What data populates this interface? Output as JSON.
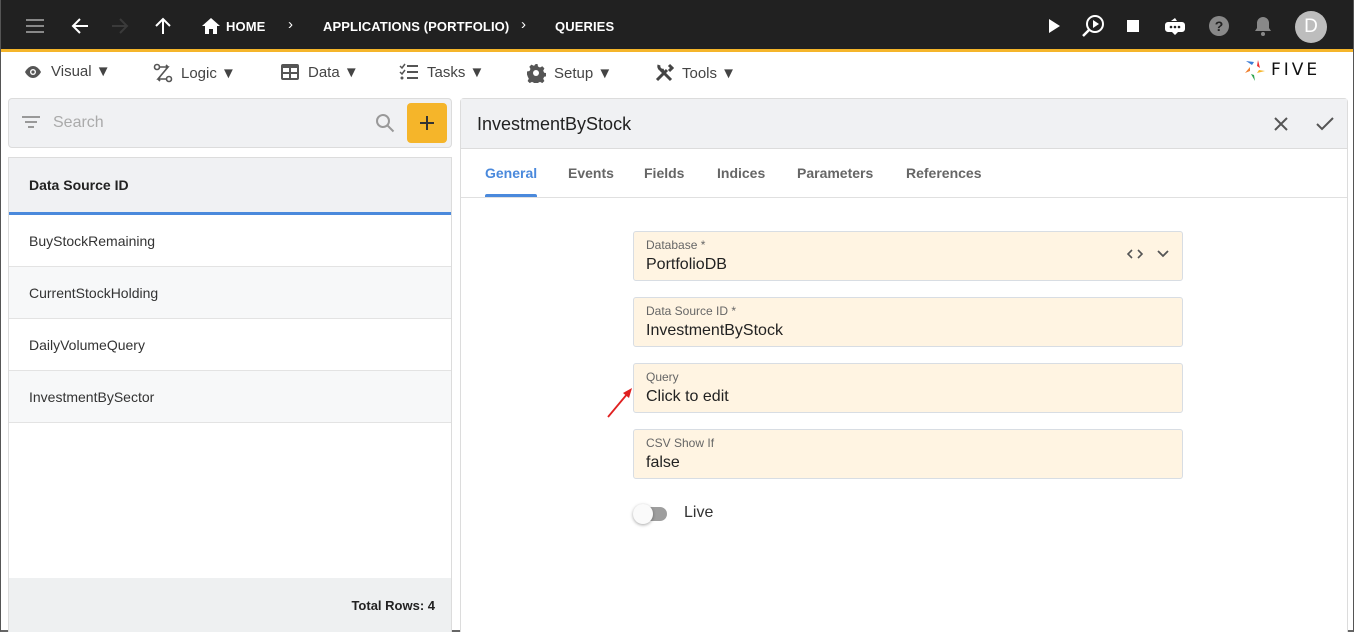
{
  "topbar": {
    "breadcrumbs": [
      {
        "label": "HOME",
        "icon": "home-icon"
      },
      {
        "label": "APPLICATIONS (PORTFOLIO)"
      },
      {
        "label": "QUERIES"
      }
    ],
    "icons": [
      "menu-icon",
      "back-arrow-icon",
      "forward-arrow-icon",
      "up-arrow-icon",
      "play-icon",
      "search-play-icon",
      "stop-icon",
      "chat-bot-icon",
      "help-icon",
      "bell-icon"
    ],
    "avatar_initial": "D",
    "accent_color": "#f5b52a"
  },
  "menubar": {
    "items": [
      {
        "label": "Visual ▼",
        "icon": "eye-icon"
      },
      {
        "label": "Logic ▼",
        "icon": "logic-icon"
      },
      {
        "label": "Data ▼",
        "icon": "table-icon"
      },
      {
        "label": "Tasks ▼",
        "icon": "tasks-icon"
      },
      {
        "label": "Setup ▼",
        "icon": "gear-icon"
      },
      {
        "label": "Tools ▼",
        "icon": "tools-icon"
      }
    ],
    "logo_text": "FIVE"
  },
  "left_panel": {
    "search": {
      "placeholder": "Search",
      "value": ""
    },
    "list_header": "Data Source ID",
    "rows": [
      "BuyStockRemaining",
      "CurrentStockHolding",
      "DailyVolumeQuery",
      "InvestmentBySector"
    ],
    "footer": "Total Rows: 4"
  },
  "right_panel": {
    "title": "InvestmentByStock",
    "tabs": [
      {
        "label": "General",
        "active": true
      },
      {
        "label": "Events"
      },
      {
        "label": "Fields"
      },
      {
        "label": "Indices"
      },
      {
        "label": "Parameters"
      },
      {
        "label": "References"
      }
    ],
    "fields": [
      {
        "label": "Database *",
        "value": "PortfolioDB"
      },
      {
        "label": "Data Source ID *",
        "value": "InvestmentByStock"
      },
      {
        "label": "Query",
        "value": "Click to edit"
      },
      {
        "label": "CSV Show If",
        "value": "false"
      }
    ],
    "toggle": {
      "label": "Live",
      "on": false
    }
  },
  "colors": {
    "primary": "#4a89dc",
    "field_bg": "#fff4e2",
    "annotation": "#e02020"
  }
}
